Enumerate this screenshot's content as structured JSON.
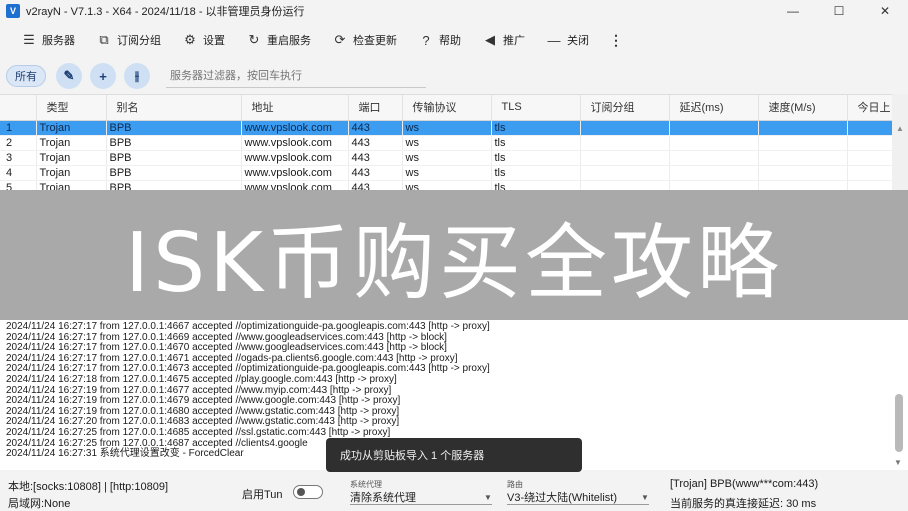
{
  "window": {
    "title": "v2rayN - V7.1.3 - X64 - 2024/11/18 - 以非管理员身份运行",
    "logo_text": "V",
    "minimize_glyph": "—",
    "maximize_glyph": "☐",
    "close_glyph": "✕"
  },
  "toolbar": {
    "servers": {
      "label": "服务器",
      "icon": "server-icon",
      "glyph": "☰"
    },
    "subscription": {
      "label": "订阅分组",
      "icon": "subscription-icon",
      "glyph": "⧉"
    },
    "settings": {
      "label": "设置",
      "icon": "gear-icon",
      "glyph": "⚙"
    },
    "restart": {
      "label": "重启服务",
      "icon": "restart-icon",
      "glyph": "↻"
    },
    "check_update": {
      "label": "检查更新",
      "icon": "update-icon",
      "glyph": "⟳"
    },
    "help": {
      "label": "帮助",
      "icon": "help-icon",
      "glyph": "?"
    },
    "promote": {
      "label": "推广",
      "icon": "megaphone-icon",
      "glyph": "◀"
    },
    "close": {
      "label": "关闭",
      "icon": "minus-icon",
      "glyph": "—"
    },
    "more_glyph": "⋮"
  },
  "filter": {
    "all_label": "所有",
    "edit_glyph": "✎",
    "add_glyph": "+",
    "split_glyph": "⫲",
    "placeholder": "服务器过滤器，按回车执行"
  },
  "table": {
    "columns": [
      "",
      "类型",
      "别名",
      "地址",
      "端口",
      "传输协议",
      "TLS",
      "订阅分组",
      "延迟(ms)",
      "速度(M/s)",
      "今日上"
    ],
    "rows": [
      {
        "idx": "1",
        "type": "Trojan",
        "alias": "BPB",
        "address": "www.vpslook.com",
        "port": "443",
        "transport": "ws",
        "tls": "tls",
        "sub": "",
        "delay": "",
        "speed": "",
        "today": ""
      },
      {
        "idx": "2",
        "type": "Trojan",
        "alias": "BPB",
        "address": "www.vpslook.com",
        "port": "443",
        "transport": "ws",
        "tls": "tls",
        "sub": "",
        "delay": "",
        "speed": "",
        "today": ""
      },
      {
        "idx": "3",
        "type": "Trojan",
        "alias": "BPB",
        "address": "www.vpslook.com",
        "port": "443",
        "transport": "ws",
        "tls": "tls",
        "sub": "",
        "delay": "",
        "speed": "",
        "today": ""
      },
      {
        "idx": "4",
        "type": "Trojan",
        "alias": "BPB",
        "address": "www.vpslook.com",
        "port": "443",
        "transport": "ws",
        "tls": "tls",
        "sub": "",
        "delay": "",
        "speed": "",
        "today": ""
      },
      {
        "idx": "5",
        "type": "Trojan",
        "alias": "BPB",
        "address": "www.vpslook.com",
        "port": "443",
        "transport": "ws",
        "tls": "tls",
        "sub": "",
        "delay": "",
        "speed": "",
        "today": ""
      }
    ],
    "selected_index": 0,
    "selected_color": "#3b9cf0"
  },
  "banner": {
    "text": "ISK币购买全攻略",
    "background": "#a9a9a9"
  },
  "log": {
    "lines": [
      "2024/11/24 16:27:17 from 127.0.0.1:4667 accepted //optimizationguide-pa.googleapis.com:443 [http -> proxy]",
      "2024/11/24 16:27:17 from 127.0.0.1:4669 accepted //www.googleadservices.com:443 [http -> block]",
      "2024/11/24 16:27:17 from 127.0.0.1:4670 accepted //www.googleadservices.com:443 [http -> block]",
      "2024/11/24 16:27:17 from 127.0.0.1:4671 accepted //ogads-pa.clients6.google.com:443 [http -> proxy]",
      "2024/11/24 16:27:17 from 127.0.0.1:4673 accepted //optimizationguide-pa.googleapis.com:443 [http -> proxy]",
      "2024/11/24 16:27:18 from 127.0.0.1:4675 accepted //play.google.com:443 [http -> proxy]",
      "2024/11/24 16:27:19 from 127.0.0.1:4677 accepted //www.myip.com:443 [http -> proxy]",
      "2024/11/24 16:27:19 from 127.0.0.1:4679 accepted //www.google.com:443 [http -> proxy]",
      "2024/11/24 16:27:19 from 127.0.0.1:4680 accepted //www.gstatic.com:443 [http -> proxy]",
      "2024/11/24 16:27:20 from 127.0.0.1:4683 accepted //www.gstatic.com:443 [http -> proxy]",
      "2024/11/24 16:27:25 from 127.0.0.1:4685 accepted //ssl.gstatic.com:443 [http -> proxy]",
      "2024/11/24 16:27:25 from 127.0.0.1:4687 accepted //clients4.google",
      "2024/11/24 16:27:31 系统代理设置改变 - ForcedClear"
    ]
  },
  "toast": {
    "message": "成功从剪贴板导入 1 个服务器"
  },
  "status": {
    "local_ports": "本地:[socks:10808] | [http:10809]",
    "lan": "局域网:None",
    "tun_label": "启用Tun",
    "tun_enabled": false,
    "system_proxy_caption": "系统代理",
    "system_proxy_value": "清除系统代理",
    "routing_caption": "路由",
    "routing_value": "V3-绕过大陆(Whitelist)",
    "current_server": "[Trojan] BPB(www***com:443)",
    "current_delay": "当前服务的真连接延迟: 30 ms",
    "chevron_glyph": "▼"
  }
}
